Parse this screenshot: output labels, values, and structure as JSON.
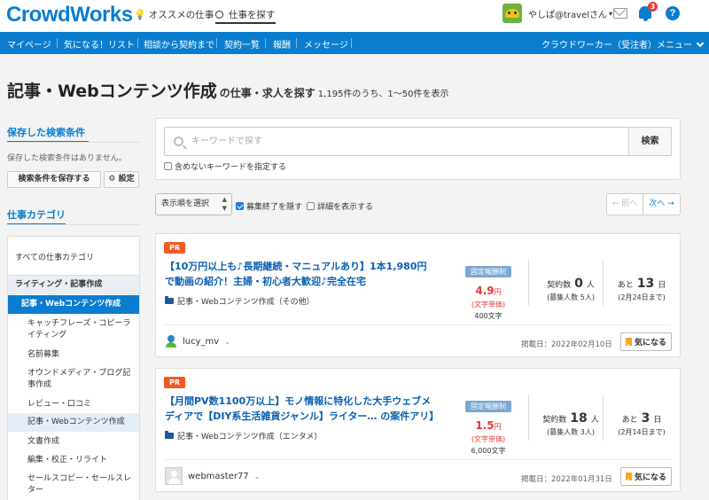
{
  "header": {
    "logo": "CrowdWorks",
    "recommend_link": "オススメの仕事",
    "search_link": "仕事を探す",
    "username": "やしぱ@travelさん",
    "notification_count": "3",
    "help_label": "?"
  },
  "nav": {
    "items": [
      "マイページ",
      "気になる！リスト",
      "相談から契約まで",
      "契約一覧",
      "報酬",
      "メッセージ"
    ],
    "right_menu": "クラウドワーカー（受注者）メニュー"
  },
  "page": {
    "title": "記事・Webコンテンツ作成",
    "subtitle": "の仕事・求人を探す",
    "count": "1,195件のうち、1〜50件を表示"
  },
  "sidebar": {
    "saved_title": "保存した検索条件",
    "saved_note": "保存した検索条件はありません。",
    "save_button": "検索条件を保存する",
    "settings_button": "設定",
    "settings_icon": "⚙",
    "category_title": "仕事カテゴリ",
    "categories": [
      "すべての仕事カテゴリ",
      "ライティング・記事作成",
      "記事・Webコンテンツ作成",
      "キャッチフレーズ・コピーラ",
      "イティング",
      "名前募集",
      "オウンドメディア・ブログ記",
      "事作成",
      "レビュー・口コミ",
      "記事・Webコンテンツ作成",
      "文書作成",
      "編集・校正・リライト",
      "セールスコピー・セールスレ",
      "ター"
    ]
  },
  "search": {
    "placeholder": "キーワードで探す",
    "button": "検索",
    "exclude_label": "含めないキーワードを指定する"
  },
  "controls": {
    "sort_label": "表示順を選択",
    "hide_closed_label": "募集終了を隠す",
    "show_details_label": "詳細を表示する",
    "prev": "← 前へ",
    "next": "次へ →"
  },
  "jobs": [
    {
      "badge": "PR",
      "title": "【10万円以上も♪長期継続・マニュアルあり】1本1,980円で動画の紹介！主婦・初心者大歓迎♪完全在宅",
      "category": "記事・Webコンテンツ作成（その他）",
      "pay_type": "固定報酬制",
      "pay_amount": "4.9",
      "pay_unit": "円",
      "pay_basis": "(文字単価)",
      "pay_count": "400文字",
      "contracts_prefix": "契約数",
      "contracts": "0",
      "contracts_suffix": "人",
      "recruits": "(募集人数 5人)",
      "remaining_prefix": "あと",
      "remaining": "13",
      "remaining_suffix": "日",
      "deadline": "(2月24日まで)",
      "client": "lucy_mv",
      "posted": "掲載日：2022年02月10日",
      "fav_label": "気になる"
    },
    {
      "badge": "PR",
      "title": "【月間PV数1100万以上】モノ情報に特化した大手ウェブメディアで【DIY系生活雑貨ジャンル】ライター… の案件アリ】",
      "category": "記事・Webコンテンツ作成（エンタメ）",
      "pay_type": "固定報酬制",
      "pay_amount": "1.5",
      "pay_unit": "円",
      "pay_basis": "(文字単価)",
      "pay_count": "6,000文字",
      "contracts_prefix": "契約数",
      "contracts": "18",
      "contracts_suffix": "人",
      "recruits": "(募集人数 3人)",
      "remaining_prefix": "あと",
      "remaining": "3",
      "remaining_suffix": "日",
      "deadline": "(2月14日まで)",
      "client": "webmaster77",
      "posted": "掲載日：2022年01月31日",
      "fav_label": "気になる"
    }
  ],
  "colors": {
    "brand": "#0a7dcf",
    "pr": "#f05a22",
    "price": "#e53935",
    "pay_label": "#7aa7d3"
  }
}
